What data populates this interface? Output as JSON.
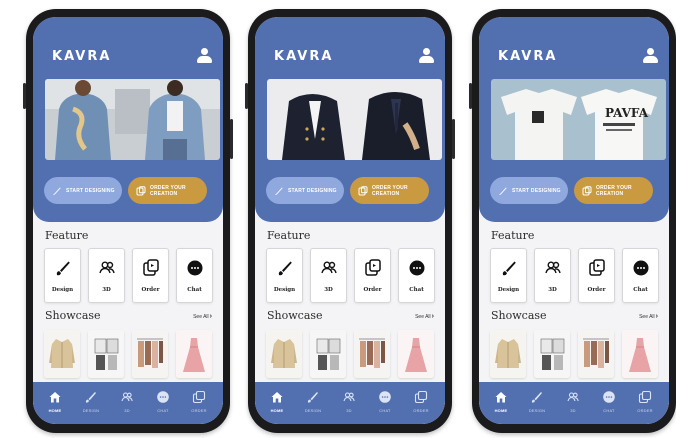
{
  "screens": [
    {
      "brand": "KAVRA",
      "banner": "denim-jackets",
      "cta": {
        "start_label": "START DESIGNING",
        "order_label_1": "ORDER YOUR",
        "order_label_2": "CREATION"
      },
      "feature_title": "Feature",
      "features": [
        {
          "label": "Design",
          "icon": "brush-icon"
        },
        {
          "label": "3D",
          "icon": "users-icon"
        },
        {
          "label": "Order",
          "icon": "order-icon"
        },
        {
          "label": "Chat",
          "icon": "chat-icon"
        }
      ],
      "showcase_title": "Showcase",
      "see_all": "See All",
      "nav": [
        {
          "label": "HOME",
          "icon": "home-icon"
        },
        {
          "label": "DESIGN",
          "icon": "brush-icon"
        },
        {
          "label": "3D",
          "icon": "users-icon"
        },
        {
          "label": "CHAT",
          "icon": "chat-icon"
        },
        {
          "label": "ORDER",
          "icon": "order-icon"
        }
      ]
    },
    {
      "brand": "KAVRA",
      "banner": "blazers",
      "cta": {
        "start_label": "START DESIGNING",
        "order_label_1": "ORDER YOUR",
        "order_label_2": "CREATION"
      },
      "feature_title": "Feature",
      "features": [
        {
          "label": "Design",
          "icon": "brush-icon"
        },
        {
          "label": "3D",
          "icon": "users-icon"
        },
        {
          "label": "Order",
          "icon": "order-icon"
        },
        {
          "label": "Chat",
          "icon": "chat-icon"
        }
      ],
      "showcase_title": "Showcase",
      "see_all": "See All",
      "nav": [
        {
          "label": "HOME",
          "icon": "home-icon"
        },
        {
          "label": "DESIGN",
          "icon": "brush-icon"
        },
        {
          "label": "3D",
          "icon": "users-icon"
        },
        {
          "label": "CHAT",
          "icon": "chat-icon"
        },
        {
          "label": "ORDER",
          "icon": "order-icon"
        }
      ]
    },
    {
      "brand": "KAVRA",
      "banner": "t-shirts",
      "cta": {
        "start_label": "START DESIGNING",
        "order_label_1": "ORDER YOUR",
        "order_label_2": "CREATION"
      },
      "feature_title": "Feature",
      "features": [
        {
          "label": "Design",
          "icon": "brush-icon"
        },
        {
          "label": "3D",
          "icon": "users-icon"
        },
        {
          "label": "Order",
          "icon": "order-icon"
        },
        {
          "label": "Chat",
          "icon": "chat-icon"
        }
      ],
      "showcase_title": "Showcase",
      "see_all": "See All",
      "nav": [
        {
          "label": "HOME",
          "icon": "home-icon"
        },
        {
          "label": "DESIGN",
          "icon": "brush-icon"
        },
        {
          "label": "3D",
          "icon": "users-icon"
        },
        {
          "label": "CHAT",
          "icon": "chat-icon"
        },
        {
          "label": "ORDER",
          "icon": "order-icon"
        }
      ]
    }
  ],
  "colors": {
    "primary": "#5270b0",
    "accent_gold": "#c99a40",
    "accent_light": "#8fa8dd",
    "background": "#f4f4f6"
  }
}
